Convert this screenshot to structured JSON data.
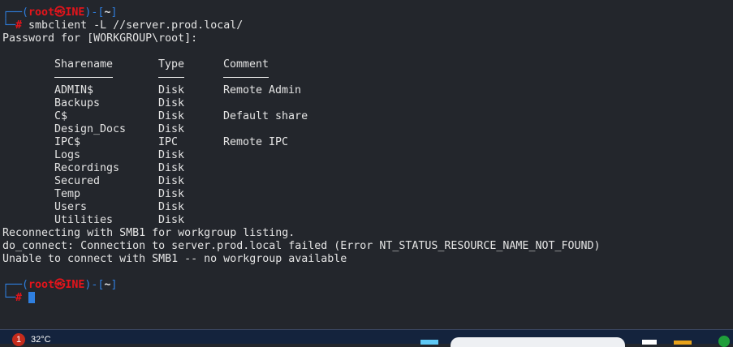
{
  "prompt": {
    "user": "root",
    "symbol": "㉿",
    "host": "INE",
    "dir": "~",
    "hash": "#"
  },
  "command": "smbclient -L //server.prod.local/",
  "password_line": "Password for [WORKGROUP\\root]:",
  "table": {
    "headers": [
      "Sharename",
      "Type",
      "Comment"
    ],
    "rows": [
      [
        "ADMIN$",
        "Disk",
        "Remote Admin"
      ],
      [
        "Backups",
        "Disk",
        ""
      ],
      [
        "C$",
        "Disk",
        "Default share"
      ],
      [
        "Design_Docs",
        "Disk",
        ""
      ],
      [
        "IPC$",
        "IPC",
        "Remote IPC"
      ],
      [
        "Logs",
        "Disk",
        ""
      ],
      [
        "Recordings",
        "Disk",
        ""
      ],
      [
        "Secured",
        "Disk",
        ""
      ],
      [
        "Temp",
        "Disk",
        ""
      ],
      [
        "Users",
        "Disk",
        ""
      ],
      [
        "Utilities",
        "Disk",
        ""
      ]
    ]
  },
  "messages": [
    "Reconnecting with SMB1 for workgroup listing.",
    "do_connect: Connection to server.prod.local failed (Error NT_STATUS_RESOURCE_NAME_NOT_FOUND)",
    "Unable to connect with SMB1 -- no workgroup available"
  ],
  "taskbar": {
    "weather_badge": "1",
    "temperature": "32°C"
  },
  "colors": {
    "background": "#23262c",
    "prompt_blue": "#2f7fe0",
    "prompt_red": "#e5141b",
    "taskbar": "#14233d"
  }
}
